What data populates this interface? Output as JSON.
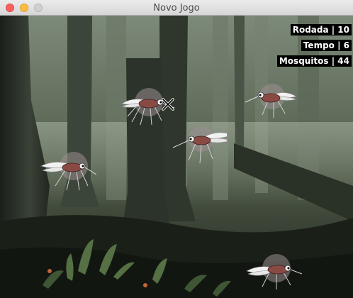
{
  "window": {
    "title": "Novo Jogo"
  },
  "hud": {
    "round": "Rodada | 10",
    "time": "Tempo | 6",
    "mosquitoes": "Mosquitos | 44"
  },
  "icons": {
    "close": "close-icon",
    "minimize": "minimize-icon",
    "maximize": "maximize-icon",
    "crosshair": "crosshair-icon",
    "mosquito": "mosquito-icon"
  },
  "colors": {
    "forest_dark": "#1f2520",
    "mosquito_body": "#8a4a44",
    "hud_bg": "#000000",
    "hud_text": "#ffffff"
  }
}
